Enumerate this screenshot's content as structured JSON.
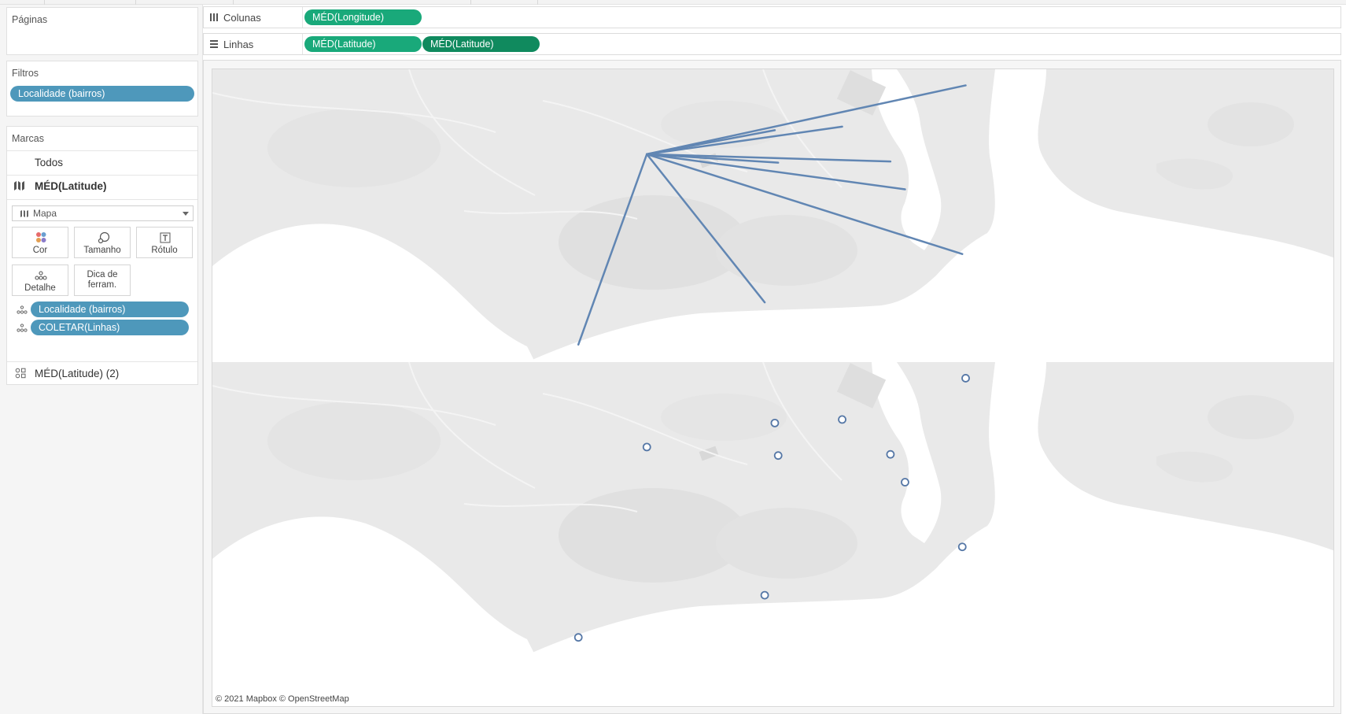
{
  "pages": {
    "title": "Páginas"
  },
  "filters": {
    "title": "Filtros",
    "pill": "Localidade (bairros)"
  },
  "marks": {
    "title": "Marcas",
    "all": "Todos",
    "layer_primary": "MÉD(Latitude)",
    "mark_type": "Mapa",
    "buttons": {
      "color": "Cor",
      "size": "Tamanho",
      "label": "Rótulo",
      "detail": "Detalhe",
      "tooltip_line1": "Dica de",
      "tooltip_line2": "ferram."
    },
    "fields": [
      "Localidade (bairros)",
      "COLETAR(Linhas)"
    ],
    "layer_secondary": "MÉD(Latitude) (2)"
  },
  "shelves": {
    "columns": {
      "label": "Colunas",
      "pills": [
        "MÉD(Longitude)"
      ]
    },
    "rows": {
      "label": "Linhas",
      "pills": [
        "MÉD(Latitude)",
        "MÉD(Latitude)"
      ]
    }
  },
  "map": {
    "attribution": "© 2021 Mapbox © OpenStreetMap",
    "line_color": "#6186b3",
    "marker_color": "#5577a6",
    "hub": [
      0.387,
      0.29
    ],
    "points": [
      [
        0.671,
        0.055
      ],
      [
        0.561,
        0.196
      ],
      [
        0.501,
        0.208
      ],
      [
        0.504,
        0.319
      ],
      [
        0.604,
        0.315
      ],
      [
        0.617,
        0.41
      ],
      [
        0.668,
        0.631
      ],
      [
        0.492,
        0.796
      ],
      [
        0.326,
        0.94
      ]
    ]
  },
  "colors": {
    "filter_pill": "#4e98bb",
    "shelf_pill": "#19a97a",
    "shelf_pill_dark": "#108a5e"
  }
}
